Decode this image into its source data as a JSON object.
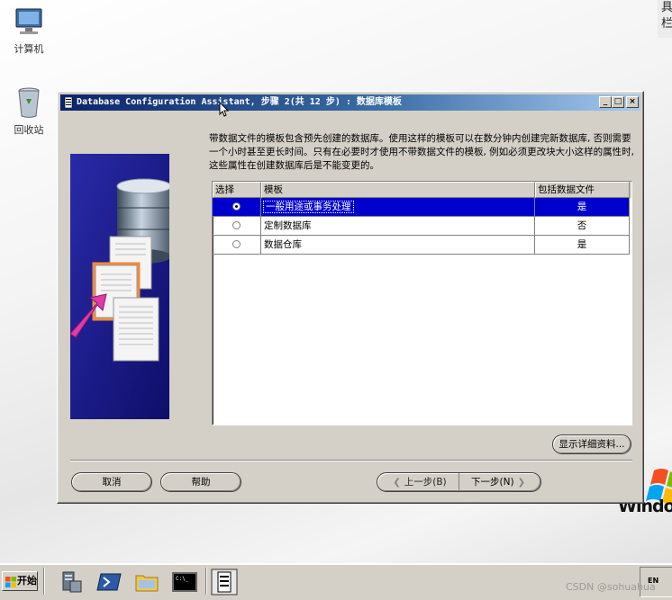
{
  "desktop": {
    "icons": [
      {
        "label": "计算机"
      },
      {
        "label": "回收站"
      }
    ],
    "corner_text": "具\n栏",
    "os_logo_text": "Window"
  },
  "dialog": {
    "title": "Database Configuration Assistant, 步骤 2(共 12 步) : 数据库模板",
    "description": "带数据文件的模板包含预先创建的数据库。使用这样的模板可以在数分钟内创建完新数据库, 否则需要一个小时甚至更长时间。只有在必要时才使用不带数据文件的模板, 例如必须更改块大小这样的属性时, 这些属性在创建数据库后是不能变更的。",
    "table": {
      "headers": [
        "选择",
        "模板",
        "包括数据文件"
      ],
      "rows": [
        {
          "template": "一般用途或事务处理",
          "includes_datafiles": "是",
          "selected": true
        },
        {
          "template": "定制数据库",
          "includes_datafiles": "否",
          "selected": false
        },
        {
          "template": "数据仓库",
          "includes_datafiles": "是",
          "selected": false
        }
      ]
    },
    "buttons": {
      "details": "显示详细资料...",
      "cancel": "取消",
      "help": "帮助",
      "back": "上一步(B)",
      "next": "下一步(N)"
    },
    "title_buttons": {
      "minimize": "_",
      "maximize": "□",
      "close": "×"
    }
  },
  "taskbar": {
    "start_label": "开始",
    "language": "EN"
  },
  "watermark": "CSDN @sohuahua",
  "colors": {
    "title_active": "#0a246a",
    "selection": "#0000cc",
    "face": "#d4d0c8",
    "side_panel": "#1c1c8c"
  }
}
